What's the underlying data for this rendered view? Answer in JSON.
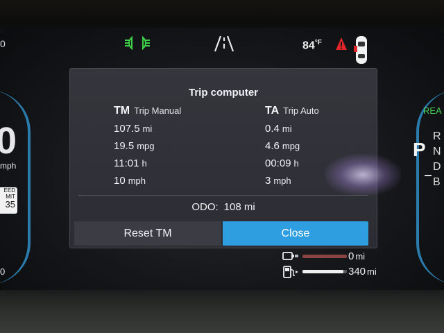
{
  "status_bar": {
    "left_fragment": "0",
    "outside_temp": "84",
    "temp_unit": "°F",
    "icons": [
      "headlights-on-icon",
      "lane-keeping-icon",
      "alert-icon",
      "door-open-car-icon"
    ]
  },
  "left_edge": {
    "speed_fragment": "0",
    "speed_unit_fragment": "mph",
    "speed_limit_label_1": "EED",
    "speed_limit_label_2": "MIT",
    "speed_limit_value": "35",
    "gauge_fragment": "0"
  },
  "right_edge": {
    "ready_fragment": "REA",
    "gear_selected": "P",
    "gear_r": "R",
    "gear_n": "N",
    "gear_d": "D",
    "gear_b": "B"
  },
  "trip_computer": {
    "title": "Trip computer",
    "tm": {
      "code": "TM",
      "label": "Trip Manual",
      "distance": "107.5",
      "distance_unit": "mi",
      "efficiency": "19.5",
      "efficiency_unit": "mpg",
      "time": "11:01",
      "time_unit": "h",
      "avg_speed": "10",
      "avg_speed_unit": "mph"
    },
    "ta": {
      "code": "TA",
      "label": "Trip Auto",
      "distance": "0.4",
      "distance_unit": "mi",
      "efficiency": "4.6",
      "efficiency_unit": "mpg",
      "time": "00:09",
      "time_unit": "h",
      "avg_speed": "3",
      "avg_speed_unit": "mph"
    },
    "odo_label": "ODO:",
    "odo_value": "108 mi",
    "reset_label": "Reset TM",
    "close_label": "Close"
  },
  "range": {
    "electric_value": "0",
    "electric_unit": "mi",
    "electric_fraction": 0.0,
    "fuel_value": "340",
    "fuel_unit": "mi",
    "fuel_fraction": 0.92
  },
  "colors": {
    "accent_blue": "#2f9ee0",
    "ready_green": "#47d05a",
    "light_indicator_green": "#3fd14a",
    "alert_red": "#e0262b"
  }
}
